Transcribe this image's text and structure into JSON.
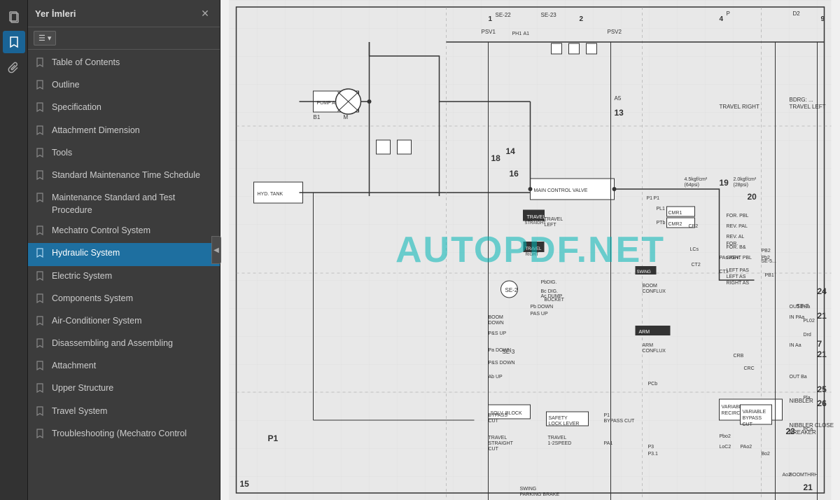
{
  "leftToolbar": {
    "icons": [
      {
        "name": "pages-icon",
        "symbol": "⬜",
        "active": false
      },
      {
        "name": "bookmarks-icon",
        "symbol": "🔖",
        "active": true
      },
      {
        "name": "attachments-icon",
        "symbol": "📎",
        "active": false
      }
    ]
  },
  "sidebar": {
    "title": "Yer İmleri",
    "closeLabel": "✕",
    "toolbarBtn": {
      "icon": "☰",
      "arrow": "▾"
    },
    "items": [
      {
        "label": "Table of Contents",
        "active": false
      },
      {
        "label": "Outline",
        "active": false
      },
      {
        "label": "Specification",
        "active": false
      },
      {
        "label": "Attachment Dimension",
        "active": false
      },
      {
        "label": "Tools",
        "active": false
      },
      {
        "label": "Standard Maintenance Time Schedule",
        "active": false
      },
      {
        "label": "Maintenance Standard and Test Procedure",
        "active": false
      },
      {
        "label": "Mechatro Control System",
        "active": false
      },
      {
        "label": "Hydraulic System",
        "active": true
      },
      {
        "label": "Electric System",
        "active": false
      },
      {
        "label": "Components System",
        "active": false
      },
      {
        "label": "Air-Conditioner System",
        "active": false
      },
      {
        "label": "Disassembling and Assembling",
        "active": false
      },
      {
        "label": "Attachment",
        "active": false
      },
      {
        "label": "Upper Structure",
        "active": false
      },
      {
        "label": "Travel System",
        "active": false
      },
      {
        "label": "Troubleshooting (Mechatro Control",
        "active": false
      }
    ]
  },
  "diagram": {
    "watermark": "AUTOPDF.NET"
  },
  "collapseHandle": {
    "symbol": "◀"
  }
}
